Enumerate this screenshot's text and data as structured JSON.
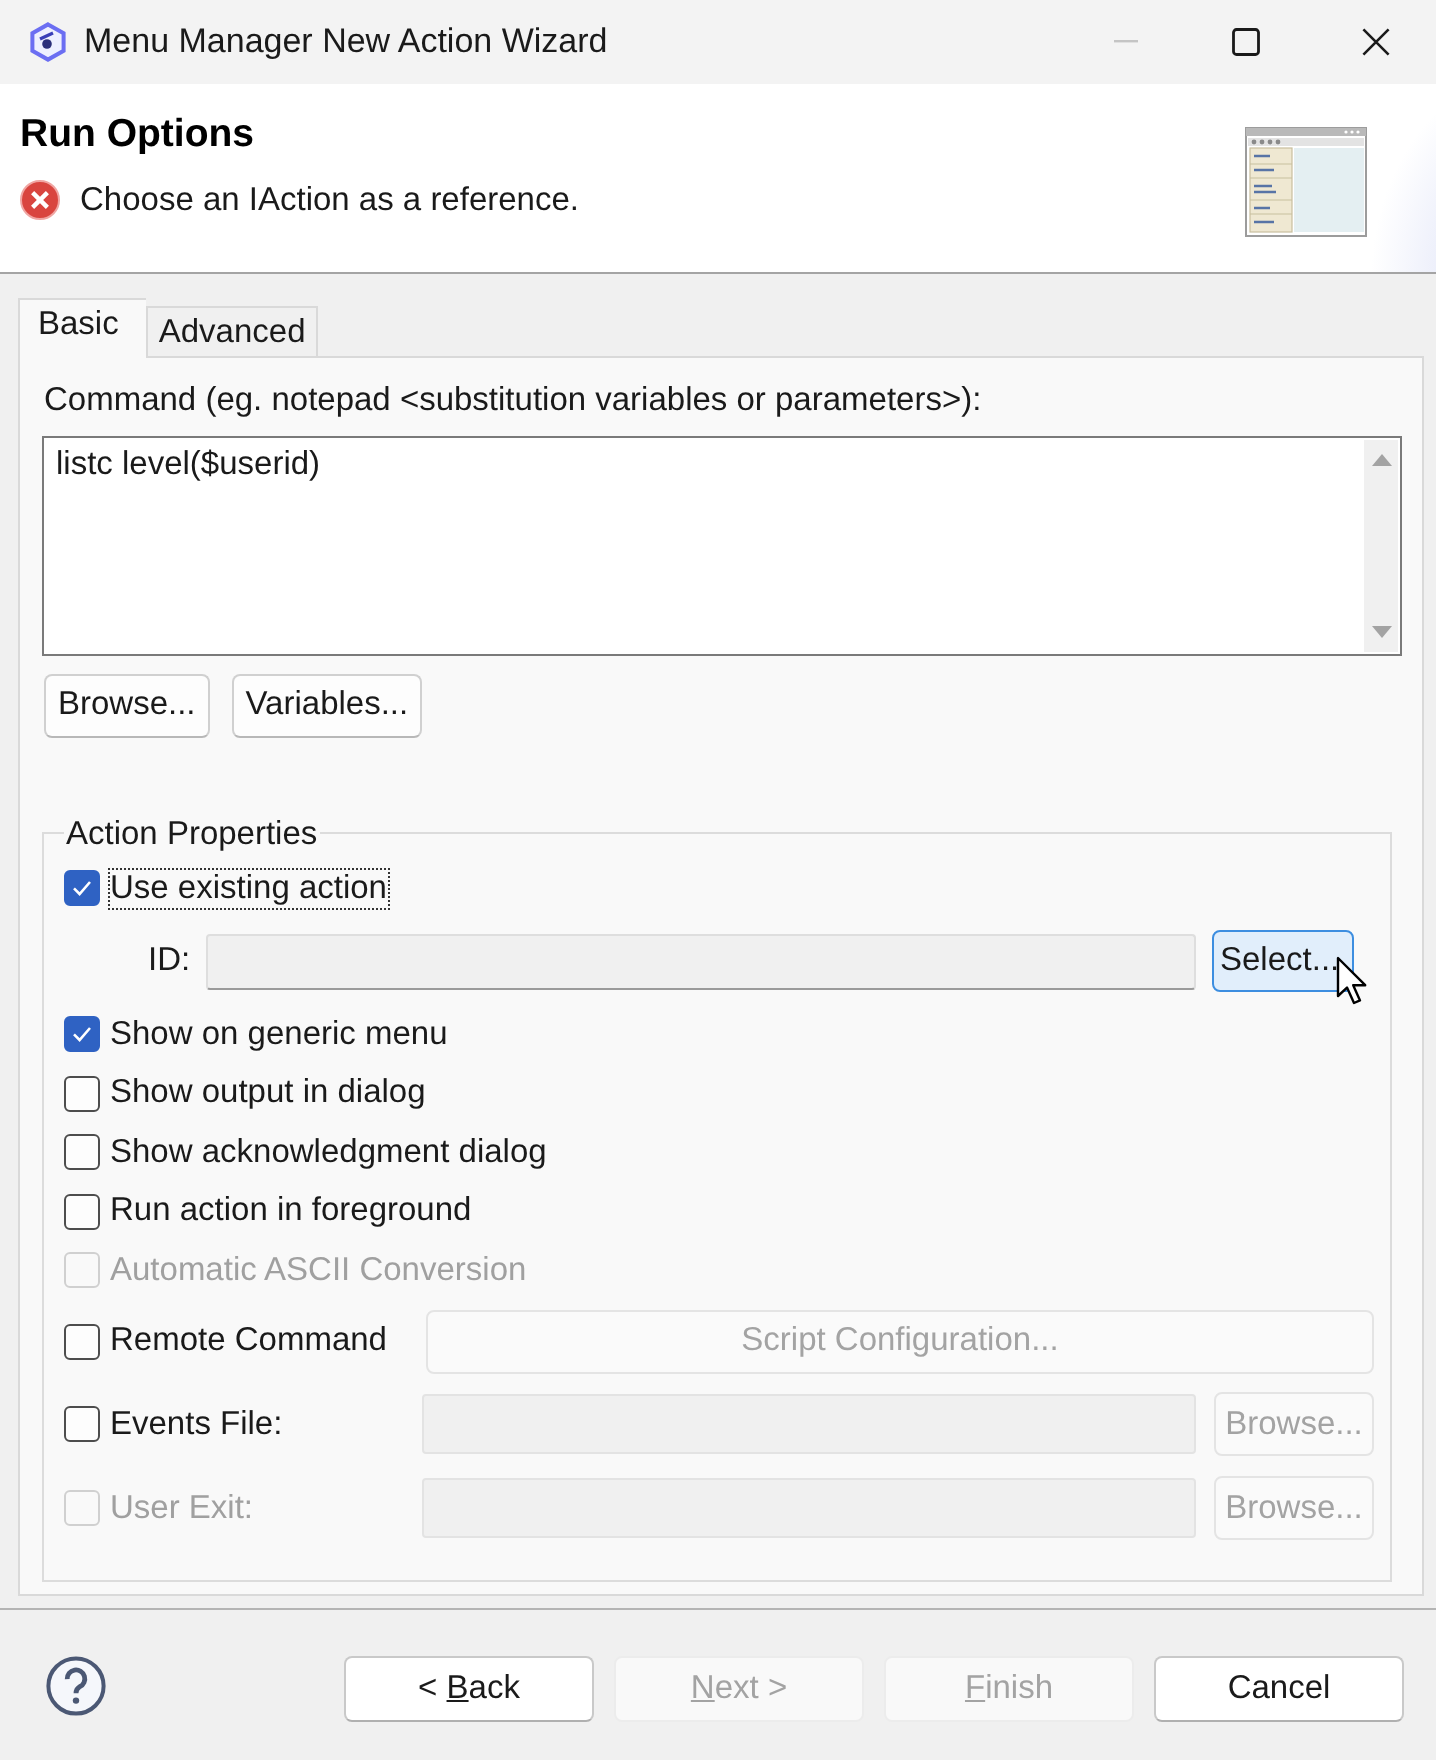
{
  "window": {
    "title": "Menu Manager New Action Wizard"
  },
  "header": {
    "title": "Run Options",
    "message": {
      "kind": "error",
      "text": "Choose an IAction as a reference."
    }
  },
  "tabs": [
    {
      "label": "Basic",
      "selected": true
    },
    {
      "label": "Advanced",
      "selected": false
    }
  ],
  "command": {
    "label": "Command (eg. notepad <substitution variables or parameters>):",
    "value": "listc level($userid)",
    "buttons": [
      {
        "label": "Browse..."
      },
      {
        "label": "Variables..."
      }
    ]
  },
  "action_properties": {
    "title": "Action Properties",
    "options": [
      {
        "kind": "checkbox",
        "label": "Use existing action",
        "checked": true,
        "disabled": false,
        "focused": true
      },
      {
        "kind": "id_row",
        "label": "ID:",
        "button": {
          "label": "Select...",
          "hovered": true
        }
      },
      {
        "kind": "checkbox",
        "label": "Show on generic menu",
        "checked": true,
        "disabled": false,
        "focused": false
      },
      {
        "kind": "checkbox",
        "label": "Show output in dialog",
        "checked": false,
        "disabled": false,
        "focused": false
      },
      {
        "kind": "checkbox",
        "label": "Show acknowledgment dialog",
        "checked": false,
        "disabled": false,
        "focused": false
      },
      {
        "kind": "checkbox",
        "label": "Run action in foreground",
        "checked": false,
        "disabled": false,
        "focused": false
      },
      {
        "kind": "checkbox",
        "label": "Automatic ASCII Conversion",
        "checked": false,
        "disabled": true,
        "focused": false
      },
      {
        "kind": "checkbox_button",
        "label": "Remote Command",
        "checked": false,
        "disabled": false,
        "focused": false,
        "button": {
          "label": "Script Configuration...",
          "disabled": true
        }
      },
      {
        "kind": "checkbox_file",
        "label": "Events File:",
        "checked": false,
        "disabled": false,
        "focused": false,
        "field_disabled": true,
        "button": {
          "label": "Browse...",
          "disabled": true
        }
      },
      {
        "kind": "checkbox_file",
        "label": "User Exit:",
        "checked": false,
        "disabled": true,
        "focused": false,
        "field_disabled": true,
        "button": {
          "label": "Browse...",
          "disabled": true
        }
      }
    ]
  },
  "footer": {
    "buttons": [
      {
        "before": "< ",
        "mnemonic": "B",
        "after": "ack",
        "disabled": false
      },
      {
        "mnemonic": "N",
        "after": "ext >",
        "disabled": true
      },
      {
        "mnemonic": "F",
        "after": "inish",
        "disabled": true
      },
      {
        "label": "Cancel",
        "disabled": false
      }
    ]
  }
}
